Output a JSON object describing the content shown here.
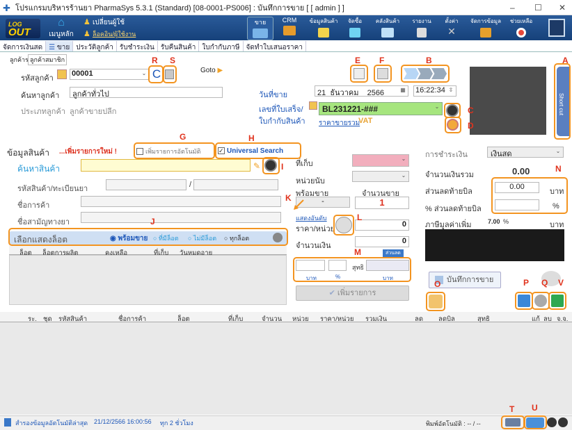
{
  "window": {
    "title": "โปรแกรมบริหารร้านยา PharmaSys 5.3.1 (Standard) [08-0001-PS006] : บันทึกการขาย [ [ admin ] ]",
    "min": "–",
    "max": "☐",
    "close": "✕"
  },
  "ribbon": {
    "logo_line1": "LOG",
    "logo_line2": "OUT",
    "home_label": "เมนูหลัก",
    "change_user_label": "เปลี่ยนผู้ใช้",
    "user_link": "ล็อคอิน/ผู้ใช้งาน",
    "buttons": [
      "ขาย",
      "CRM",
      "ข้อมูลสินค้า",
      "จัดซื้อ",
      "คลังสินค้า",
      "รายงาน",
      "ตั้งค่า",
      "จัดการข้อมูล",
      "ช่วยเหลือ"
    ]
  },
  "tabs": [
    "จัดการเงินสด",
    "ขาย",
    "ประวัติลูกค้า",
    "รับชำระเงิน",
    "รับคืนสินค้า",
    "ใบกำกับภาษี",
    "จัดทำใบเสนอราคา"
  ],
  "customer": {
    "subtabs": [
      "ลูกค้ารอ",
      "ลูกค้าสมาชิก"
    ],
    "code_label": "รหัสลูกค้า",
    "code_value": "00001",
    "search_label": "ค้นหาลูกค้า",
    "search_value": "ลูกค้าทั่วไป",
    "type_label": "ประเภทลูกค้า",
    "type_value": "ลูกค้าขายปลีก",
    "goto_label": "Goto",
    "c_button": "C"
  },
  "sale": {
    "date_label": "วันที่ขาย",
    "day": "21",
    "month": "ธันวาคม",
    "year": "2566",
    "time": "16:22:34",
    "receipt_label": "เลขที่ใบเสร็จ/",
    "receipt_value": "BL231221-###",
    "invoice_label": "ใบกำกับสินค้า",
    "price_mode": "ราคาขายรวม",
    "vat": "VAT",
    "shortcut": "Short cut"
  },
  "product": {
    "section_title": "ข้อมูลสินค้า",
    "new_item_label": "...เพิ่มรายการใหม่ !",
    "auto_add_label": "เพิ่มรายการอัตโนมัติ",
    "universal_search_label": "Universal Search",
    "search_label": "ค้นหาสินค้า",
    "code_label": "รหัสสินค้า/ทะเบียนยา",
    "trade_label": "ชื่อการค้า",
    "generic_label": "ชื่อสามัญทางยา",
    "slash": "/",
    "warehouse_label": "ที่เก็บ",
    "unit_label": "หน่วยนับ",
    "ready_label": "พร้อมขาย",
    "qty_label": "จำนวนขาย",
    "ready_value": "-",
    "qty_value": "1",
    "show_all_link": "แสดงอันดับ",
    "price_label": "ราคา/หน่วย",
    "price_value": "0",
    "amount_label": "จำนวนเงิน",
    "amount_value": "0",
    "discount_tag": "ส่วนลด",
    "net_label": "สุทธิ",
    "baht": "บาท",
    "percent": "%",
    "add_button": "เพิ่มรายการ"
  },
  "lot": {
    "title": "เลือกแสดงล็อต",
    "options": [
      "พร้อมขาย",
      "ที่มีล็อต",
      "ไม่มีล็อต",
      "ทุกล็อต"
    ],
    "columns": [
      "ล็อต",
      "ล็อตการผลิต",
      "คงเหลือ",
      "ที่เก็บ",
      "วันหมดอายุ"
    ]
  },
  "payment": {
    "method_label": "การชำระเงิน",
    "method_value": "เงินสด",
    "total_label": "จำนวนเงินรวม",
    "total_value": "0.00",
    "bill_discount_label": "ส่วนลดท้ายบิล",
    "bill_discount_value": "0.00",
    "bill_discount_unit": "บาท",
    "pct_discount_label": "% ส่วนลดท้ายบิล",
    "pct_unit": "%",
    "vat_label": "ภาษีมูลค่าเพิ่ม",
    "vat_rate": "7.00",
    "vat_pct": "%",
    "vat_unit": "บาท",
    "save_button": "บันทึกการขาย"
  },
  "items": {
    "columns": [
      "ระ.",
      "ชุด",
      "รหัสสินค้า",
      "ชื่อการค้า",
      "ล็อต",
      "ที่เก็บ",
      "จำนวน",
      "หน่วย",
      "ราคา/หน่วย",
      "รวมเงิน",
      "ลด",
      "ลดบิล",
      "สุทธิ",
      "แก้",
      "ลบ",
      "จ.จ."
    ]
  },
  "status": {
    "backup_text": "สำรองข้อมูลอัตโนมัติล่าสุด",
    "backup_time": "21/12/2566 16:00:56",
    "backup_every": "ทุก 2 ชั่วโมง",
    "printer_label": "พิมพ์อัตโนมัติ : -- / --"
  },
  "annotations": [
    "A",
    "B",
    "C",
    "D",
    "E",
    "F",
    "G",
    "H",
    "I",
    "J",
    "K",
    "L",
    "M",
    "N",
    "O",
    "P",
    "Q",
    "R",
    "S",
    "T",
    "U",
    "V"
  ],
  "colors": {
    "accent": "#f39420",
    "marker": "#e0331d",
    "ribbon": "#1d4a86",
    "pink": "#f2aebd",
    "receipt": "#a6e57e"
  }
}
